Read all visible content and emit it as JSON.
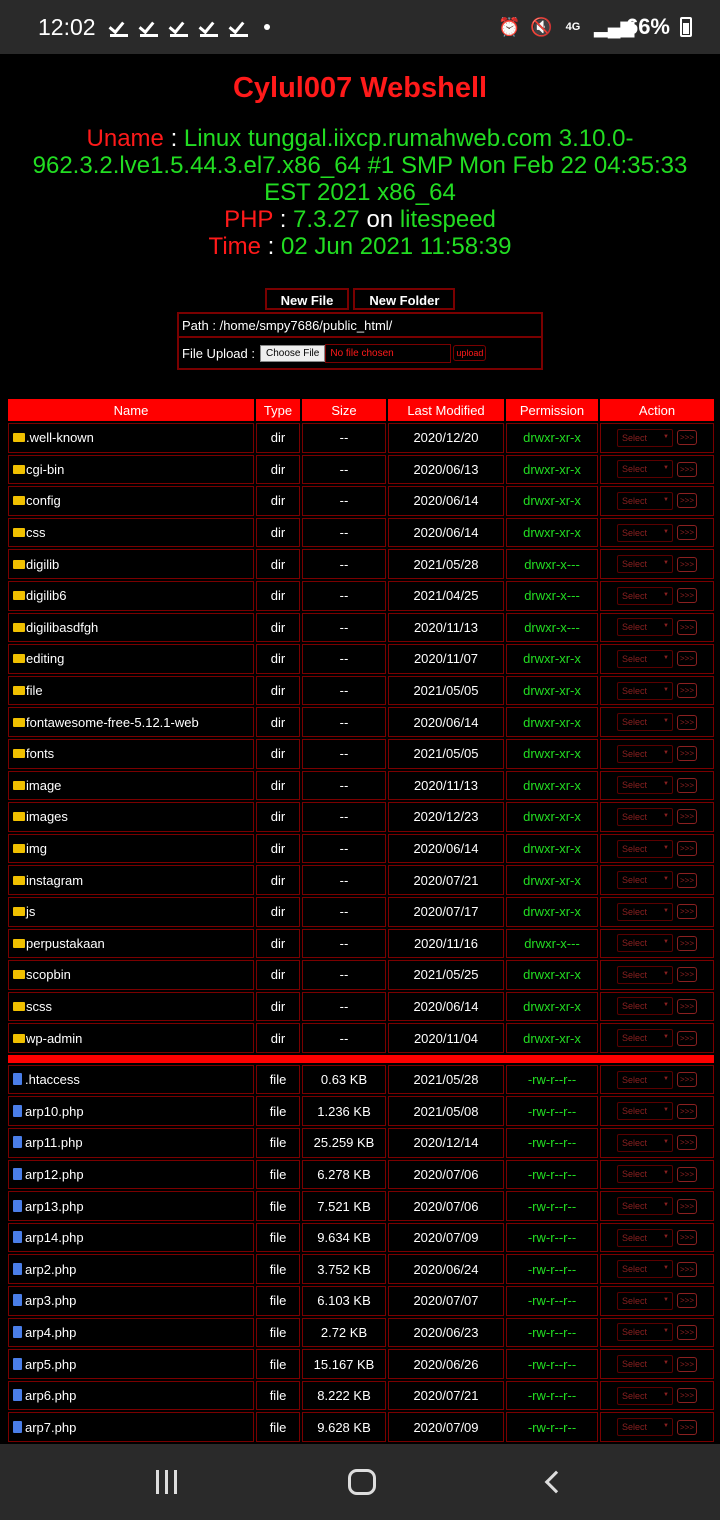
{
  "status_bar": {
    "time": "12:02",
    "battery": "66%",
    "signal": "4G"
  },
  "header": {
    "title": "Cylul007 Webshell",
    "uname_label": "Uname",
    "uname_value": "Linux tunggal.iixcp.rumahweb.com 3.10.0-962.3.2.lve1.5.44.3.el7.x86_64 #1 SMP Mon Feb 22 04:35:33 EST 2021 x86_64",
    "php_label": "PHP",
    "php_version": "7.3.27",
    "on_text": "on",
    "server": "litespeed",
    "time_label": "Time",
    "time_value": "02 Jun 2021 11:58:39",
    "sep": ":"
  },
  "toolbar": {
    "new_file": "New File",
    "new_folder": "New Folder"
  },
  "path": {
    "label": "Path : ",
    "value": "/home/smpy7686/public_html/"
  },
  "upload": {
    "label": "File Upload : ",
    "choose": "Choose File",
    "no_file": "No file chosen",
    "button": "upload"
  },
  "table": {
    "headers": [
      "Name",
      "Type",
      "Size",
      "Last Modified",
      "Permission",
      "Action"
    ],
    "select_label": "Select",
    "go_label": ">>>",
    "dirs": [
      {
        "name": ".well-known",
        "type": "dir",
        "size": "--",
        "modified": "2020/12/20",
        "perm": "drwxr-xr-x"
      },
      {
        "name": "cgi-bin",
        "type": "dir",
        "size": "--",
        "modified": "2020/06/13",
        "perm": "drwxr-xr-x"
      },
      {
        "name": "config",
        "type": "dir",
        "size": "--",
        "modified": "2020/06/14",
        "perm": "drwxr-xr-x"
      },
      {
        "name": "css",
        "type": "dir",
        "size": "--",
        "modified": "2020/06/14",
        "perm": "drwxr-xr-x"
      },
      {
        "name": "digilib",
        "type": "dir",
        "size": "--",
        "modified": "2021/05/28",
        "perm": "drwxr-x---"
      },
      {
        "name": "digilib6",
        "type": "dir",
        "size": "--",
        "modified": "2021/04/25",
        "perm": "drwxr-x---"
      },
      {
        "name": "digilibasdfgh",
        "type": "dir",
        "size": "--",
        "modified": "2020/11/13",
        "perm": "drwxr-x---"
      },
      {
        "name": "editing",
        "type": "dir",
        "size": "--",
        "modified": "2020/11/07",
        "perm": "drwxr-xr-x"
      },
      {
        "name": "file",
        "type": "dir",
        "size": "--",
        "modified": "2021/05/05",
        "perm": "drwxr-xr-x"
      },
      {
        "name": "fontawesome-free-5.12.1-web",
        "type": "dir",
        "size": "--",
        "modified": "2020/06/14",
        "perm": "drwxr-xr-x"
      },
      {
        "name": "fonts",
        "type": "dir",
        "size": "--",
        "modified": "2021/05/05",
        "perm": "drwxr-xr-x"
      },
      {
        "name": "image",
        "type": "dir",
        "size": "--",
        "modified": "2020/11/13",
        "perm": "drwxr-xr-x"
      },
      {
        "name": "images",
        "type": "dir",
        "size": "--",
        "modified": "2020/12/23",
        "perm": "drwxr-xr-x"
      },
      {
        "name": "img",
        "type": "dir",
        "size": "--",
        "modified": "2020/06/14",
        "perm": "drwxr-xr-x"
      },
      {
        "name": "instagram",
        "type": "dir",
        "size": "--",
        "modified": "2020/07/21",
        "perm": "drwxr-xr-x"
      },
      {
        "name": "js",
        "type": "dir",
        "size": "--",
        "modified": "2020/07/17",
        "perm": "drwxr-xr-x"
      },
      {
        "name": "perpustakaan",
        "type": "dir",
        "size": "--",
        "modified": "2020/11/16",
        "perm": "drwxr-x---"
      },
      {
        "name": "scopbin",
        "type": "dir",
        "size": "--",
        "modified": "2021/05/25",
        "perm": "drwxr-xr-x"
      },
      {
        "name": "scss",
        "type": "dir",
        "size": "--",
        "modified": "2020/06/14",
        "perm": "drwxr-xr-x"
      },
      {
        "name": "wp-admin",
        "type": "dir",
        "size": "--",
        "modified": "2020/11/04",
        "perm": "drwxr-xr-x"
      }
    ],
    "files": [
      {
        "name": ".htaccess",
        "type": "file",
        "size": "0.63 KB",
        "modified": "2021/05/28",
        "perm": "-rw-r--r--"
      },
      {
        "name": "arp10.php",
        "type": "file",
        "size": "1.236 KB",
        "modified": "2021/05/08",
        "perm": "-rw-r--r--"
      },
      {
        "name": "arp11.php",
        "type": "file",
        "size": "25.259 KB",
        "modified": "2020/12/14",
        "perm": "-rw-r--r--"
      },
      {
        "name": "arp12.php",
        "type": "file",
        "size": "6.278 KB",
        "modified": "2020/07/06",
        "perm": "-rw-r--r--"
      },
      {
        "name": "arp13.php",
        "type": "file",
        "size": "7.521 KB",
        "modified": "2020/07/06",
        "perm": "-rw-r--r--"
      },
      {
        "name": "arp14.php",
        "type": "file",
        "size": "9.634 KB",
        "modified": "2020/07/09",
        "perm": "-rw-r--r--"
      },
      {
        "name": "arp2.php",
        "type": "file",
        "size": "3.752 KB",
        "modified": "2020/06/24",
        "perm": "-rw-r--r--"
      },
      {
        "name": "arp3.php",
        "type": "file",
        "size": "6.103 KB",
        "modified": "2020/07/07",
        "perm": "-rw-r--r--"
      },
      {
        "name": "arp4.php",
        "type": "file",
        "size": "2.72 KB",
        "modified": "2020/06/23",
        "perm": "-rw-r--r--"
      },
      {
        "name": "arp5.php",
        "type": "file",
        "size": "15.167 KB",
        "modified": "2020/06/26",
        "perm": "-rw-r--r--"
      },
      {
        "name": "arp6.php",
        "type": "file",
        "size": "8.222 KB",
        "modified": "2020/07/21",
        "perm": "-rw-r--r--"
      },
      {
        "name": "arp7.php",
        "type": "file",
        "size": "9.628 KB",
        "modified": "2020/07/09",
        "perm": "-rw-r--r--"
      }
    ]
  }
}
